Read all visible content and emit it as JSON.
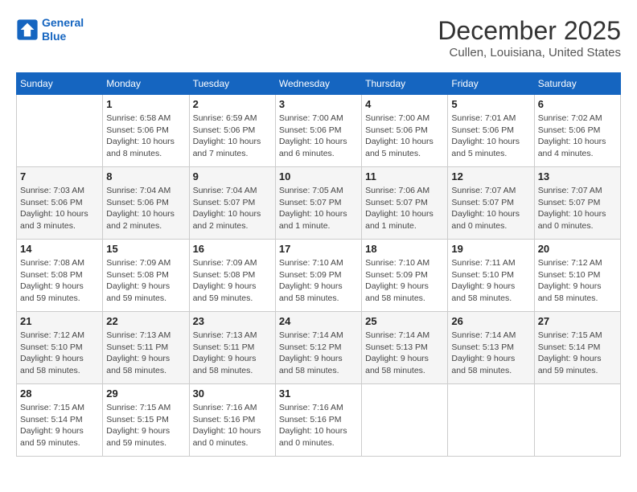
{
  "header": {
    "logo_line1": "General",
    "logo_line2": "Blue",
    "month_year": "December 2025",
    "location": "Cullen, Louisiana, United States"
  },
  "days_of_week": [
    "Sunday",
    "Monday",
    "Tuesday",
    "Wednesday",
    "Thursday",
    "Friday",
    "Saturday"
  ],
  "weeks": [
    [
      {
        "day": "",
        "sunrise": "",
        "sunset": "",
        "daylight": ""
      },
      {
        "day": "1",
        "sunrise": "Sunrise: 6:58 AM",
        "sunset": "Sunset: 5:06 PM",
        "daylight": "Daylight: 10 hours and 8 minutes."
      },
      {
        "day": "2",
        "sunrise": "Sunrise: 6:59 AM",
        "sunset": "Sunset: 5:06 PM",
        "daylight": "Daylight: 10 hours and 7 minutes."
      },
      {
        "day": "3",
        "sunrise": "Sunrise: 7:00 AM",
        "sunset": "Sunset: 5:06 PM",
        "daylight": "Daylight: 10 hours and 6 minutes."
      },
      {
        "day": "4",
        "sunrise": "Sunrise: 7:00 AM",
        "sunset": "Sunset: 5:06 PM",
        "daylight": "Daylight: 10 hours and 5 minutes."
      },
      {
        "day": "5",
        "sunrise": "Sunrise: 7:01 AM",
        "sunset": "Sunset: 5:06 PM",
        "daylight": "Daylight: 10 hours and 5 minutes."
      },
      {
        "day": "6",
        "sunrise": "Sunrise: 7:02 AM",
        "sunset": "Sunset: 5:06 PM",
        "daylight": "Daylight: 10 hours and 4 minutes."
      }
    ],
    [
      {
        "day": "7",
        "sunrise": "Sunrise: 7:03 AM",
        "sunset": "Sunset: 5:06 PM",
        "daylight": "Daylight: 10 hours and 3 minutes."
      },
      {
        "day": "8",
        "sunrise": "Sunrise: 7:04 AM",
        "sunset": "Sunset: 5:06 PM",
        "daylight": "Daylight: 10 hours and 2 minutes."
      },
      {
        "day": "9",
        "sunrise": "Sunrise: 7:04 AM",
        "sunset": "Sunset: 5:07 PM",
        "daylight": "Daylight: 10 hours and 2 minutes."
      },
      {
        "day": "10",
        "sunrise": "Sunrise: 7:05 AM",
        "sunset": "Sunset: 5:07 PM",
        "daylight": "Daylight: 10 hours and 1 minute."
      },
      {
        "day": "11",
        "sunrise": "Sunrise: 7:06 AM",
        "sunset": "Sunset: 5:07 PM",
        "daylight": "Daylight: 10 hours and 1 minute."
      },
      {
        "day": "12",
        "sunrise": "Sunrise: 7:07 AM",
        "sunset": "Sunset: 5:07 PM",
        "daylight": "Daylight: 10 hours and 0 minutes."
      },
      {
        "day": "13",
        "sunrise": "Sunrise: 7:07 AM",
        "sunset": "Sunset: 5:07 PM",
        "daylight": "Daylight: 10 hours and 0 minutes."
      }
    ],
    [
      {
        "day": "14",
        "sunrise": "Sunrise: 7:08 AM",
        "sunset": "Sunset: 5:08 PM",
        "daylight": "Daylight: 9 hours and 59 minutes."
      },
      {
        "day": "15",
        "sunrise": "Sunrise: 7:09 AM",
        "sunset": "Sunset: 5:08 PM",
        "daylight": "Daylight: 9 hours and 59 minutes."
      },
      {
        "day": "16",
        "sunrise": "Sunrise: 7:09 AM",
        "sunset": "Sunset: 5:08 PM",
        "daylight": "Daylight: 9 hours and 59 minutes."
      },
      {
        "day": "17",
        "sunrise": "Sunrise: 7:10 AM",
        "sunset": "Sunset: 5:09 PM",
        "daylight": "Daylight: 9 hours and 58 minutes."
      },
      {
        "day": "18",
        "sunrise": "Sunrise: 7:10 AM",
        "sunset": "Sunset: 5:09 PM",
        "daylight": "Daylight: 9 hours and 58 minutes."
      },
      {
        "day": "19",
        "sunrise": "Sunrise: 7:11 AM",
        "sunset": "Sunset: 5:10 PM",
        "daylight": "Daylight: 9 hours and 58 minutes."
      },
      {
        "day": "20",
        "sunrise": "Sunrise: 7:12 AM",
        "sunset": "Sunset: 5:10 PM",
        "daylight": "Daylight: 9 hours and 58 minutes."
      }
    ],
    [
      {
        "day": "21",
        "sunrise": "Sunrise: 7:12 AM",
        "sunset": "Sunset: 5:10 PM",
        "daylight": "Daylight: 9 hours and 58 minutes."
      },
      {
        "day": "22",
        "sunrise": "Sunrise: 7:13 AM",
        "sunset": "Sunset: 5:11 PM",
        "daylight": "Daylight: 9 hours and 58 minutes."
      },
      {
        "day": "23",
        "sunrise": "Sunrise: 7:13 AM",
        "sunset": "Sunset: 5:11 PM",
        "daylight": "Daylight: 9 hours and 58 minutes."
      },
      {
        "day": "24",
        "sunrise": "Sunrise: 7:14 AM",
        "sunset": "Sunset: 5:12 PM",
        "daylight": "Daylight: 9 hours and 58 minutes."
      },
      {
        "day": "25",
        "sunrise": "Sunrise: 7:14 AM",
        "sunset": "Sunset: 5:13 PM",
        "daylight": "Daylight: 9 hours and 58 minutes."
      },
      {
        "day": "26",
        "sunrise": "Sunrise: 7:14 AM",
        "sunset": "Sunset: 5:13 PM",
        "daylight": "Daylight: 9 hours and 58 minutes."
      },
      {
        "day": "27",
        "sunrise": "Sunrise: 7:15 AM",
        "sunset": "Sunset: 5:14 PM",
        "daylight": "Daylight: 9 hours and 59 minutes."
      }
    ],
    [
      {
        "day": "28",
        "sunrise": "Sunrise: 7:15 AM",
        "sunset": "Sunset: 5:14 PM",
        "daylight": "Daylight: 9 hours and 59 minutes."
      },
      {
        "day": "29",
        "sunrise": "Sunrise: 7:15 AM",
        "sunset": "Sunset: 5:15 PM",
        "daylight": "Daylight: 9 hours and 59 minutes."
      },
      {
        "day": "30",
        "sunrise": "Sunrise: 7:16 AM",
        "sunset": "Sunset: 5:16 PM",
        "daylight": "Daylight: 10 hours and 0 minutes."
      },
      {
        "day": "31",
        "sunrise": "Sunrise: 7:16 AM",
        "sunset": "Sunset: 5:16 PM",
        "daylight": "Daylight: 10 hours and 0 minutes."
      },
      {
        "day": "",
        "sunrise": "",
        "sunset": "",
        "daylight": ""
      },
      {
        "day": "",
        "sunrise": "",
        "sunset": "",
        "daylight": ""
      },
      {
        "day": "",
        "sunrise": "",
        "sunset": "",
        "daylight": ""
      }
    ]
  ]
}
